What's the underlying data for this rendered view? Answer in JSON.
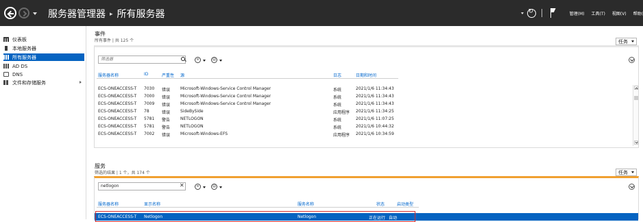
{
  "titlebar": {
    "breadcrumb_root": "服务器管理器",
    "breadcrumb_sep": "▸",
    "breadcrumb_current": "所有服务器",
    "menu": [
      "管理(M)",
      "工具(T)",
      "视图(V)",
      "帮助("
    ]
  },
  "sidebar": {
    "items": [
      {
        "label": "仪表板"
      },
      {
        "label": "本地服务器"
      },
      {
        "label": "所有服务器"
      },
      {
        "label": "AD DS"
      },
      {
        "label": "DNS"
      },
      {
        "label": "文件和存储服务"
      }
    ]
  },
  "events": {
    "title": "事件",
    "subtitle": "所有事件 | 共 125 个",
    "tasks_label": "任务",
    "filter_placeholder": "筛选器",
    "columns": [
      "服务器名称",
      "ID",
      "严重性",
      "源",
      "日志",
      "日期和时间"
    ],
    "rows": [
      [
        "ECS-ONEACCESS-T",
        "7030",
        "错误",
        "Microsoft-Windows-Service Control Manager",
        "系统",
        "2021/1/6 11:34:43"
      ],
      [
        "ECS-ONEACCESS-T",
        "7000",
        "错误",
        "Microsoft-Windows-Service Control Manager",
        "系统",
        "2021/1/6 11:34:43"
      ],
      [
        "ECS-ONEACCESS-T",
        "7009",
        "错误",
        "Microsoft-Windows-Service Control Manager",
        "系统",
        "2021/1/6 11:34:43"
      ],
      [
        "ECS-ONEACCESS-T",
        "78",
        "错误",
        "SideBySide",
        "应用程序",
        "2021/1/6 11:34:25"
      ],
      [
        "ECS-ONEACCESS-T",
        "5781",
        "警告",
        "NETLOGON",
        "系统",
        "2021/1/6 11:07:25"
      ],
      [
        "ECS-ONEACCESS-T",
        "5781",
        "警告",
        "NETLOGON",
        "系统",
        "2021/1/6 10:44:32"
      ],
      [
        "ECS-ONEACCESS-T",
        "7002",
        "错误",
        "Microsoft-Windows-EFS",
        "应用程序",
        "2021/1/6 10:34:59"
      ]
    ]
  },
  "services": {
    "title": "服务",
    "subtitle": "筛选的结果 | 1 个，共 174 个",
    "tasks_label": "任务",
    "filter_value": "netlogon",
    "clear_symbol": "✕",
    "columns": [
      "服务器名称",
      "显示名称",
      "服务名称",
      "状态",
      "启动类型"
    ],
    "rows": [
      [
        "ECS-ONEACCESS-T",
        "Netlogon",
        "Netlogon",
        "正在运行",
        "自动"
      ]
    ]
  },
  "colors": {
    "titlebar_bg": "#2b2b2b",
    "selection_blue": "#0563c1",
    "header_link_blue": "#0066cc",
    "highlight_red": "#d32f2f",
    "services_accent_orange": "#f0a030"
  }
}
